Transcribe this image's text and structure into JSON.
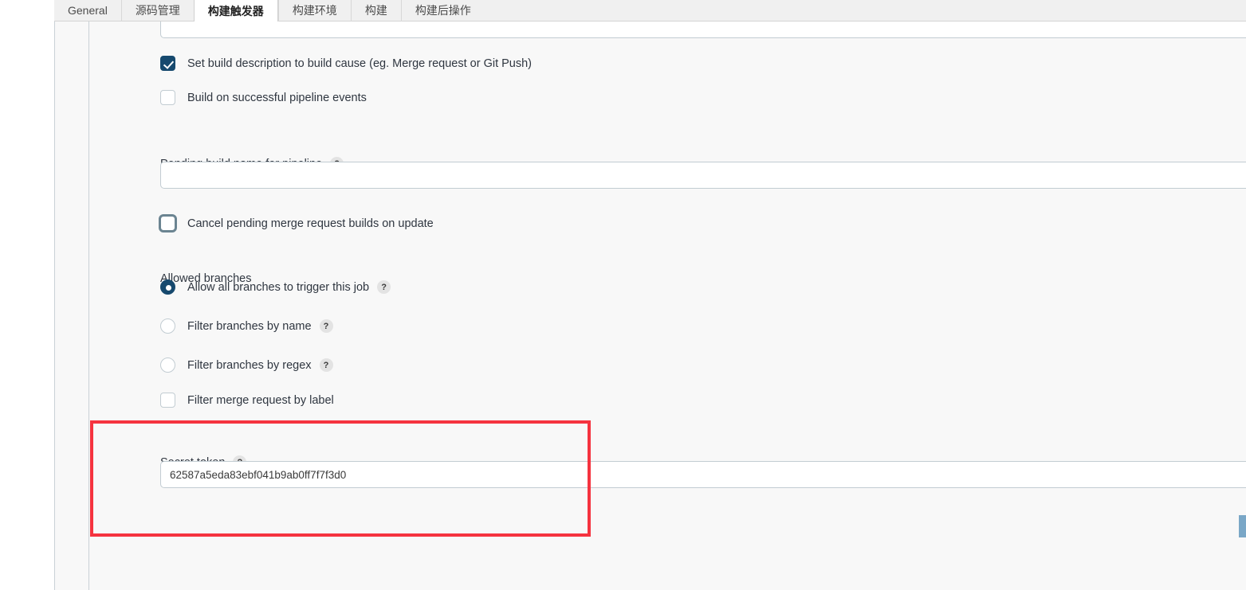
{
  "tabs": [
    {
      "label": "General",
      "active": false
    },
    {
      "label": "源码管理",
      "active": false
    },
    {
      "label": "构建触发器",
      "active": true
    },
    {
      "label": "构建环境",
      "active": false
    },
    {
      "label": "构建",
      "active": false
    },
    {
      "label": "构建后操作",
      "active": false
    }
  ],
  "form": {
    "set_build_description": {
      "label": "Set build description to build cause (eg. Merge request or Git Push)",
      "checked": true
    },
    "build_on_pipeline": {
      "label": "Build on successful pipeline events",
      "checked": false
    },
    "pending_build_name": {
      "label": "Pending build name for pipeline",
      "help": "?",
      "value": "",
      "placeholder": ""
    },
    "cancel_pending": {
      "label": "Cancel pending merge request builds on update",
      "checked": false
    },
    "allowed_branches_heading": "Allowed branches",
    "branch_options": [
      {
        "label": "Allow all branches to trigger this job",
        "help": "?",
        "selected": true
      },
      {
        "label": "Filter branches by name",
        "help": "?",
        "selected": false
      },
      {
        "label": "Filter branches by regex",
        "help": "?",
        "selected": false
      }
    ],
    "filter_merge_request_by_label": {
      "label": "Filter merge request by label",
      "checked": false
    },
    "secret_token": {
      "label": "Secret token",
      "help": "?",
      "value": "62587a5eda83ebf041b9ab0ff7f7f3d0",
      "placeholder": ""
    }
  },
  "annotation": {
    "color": "#f5333f",
    "name": "secret-token-highlight"
  },
  "colors": {
    "accent": "#16496e",
    "panel_bg": "#f8f8f8",
    "tabbar_bg": "#f0f0f0",
    "border": "#c2ccd2",
    "scrollbar": "#7aa7c7"
  }
}
